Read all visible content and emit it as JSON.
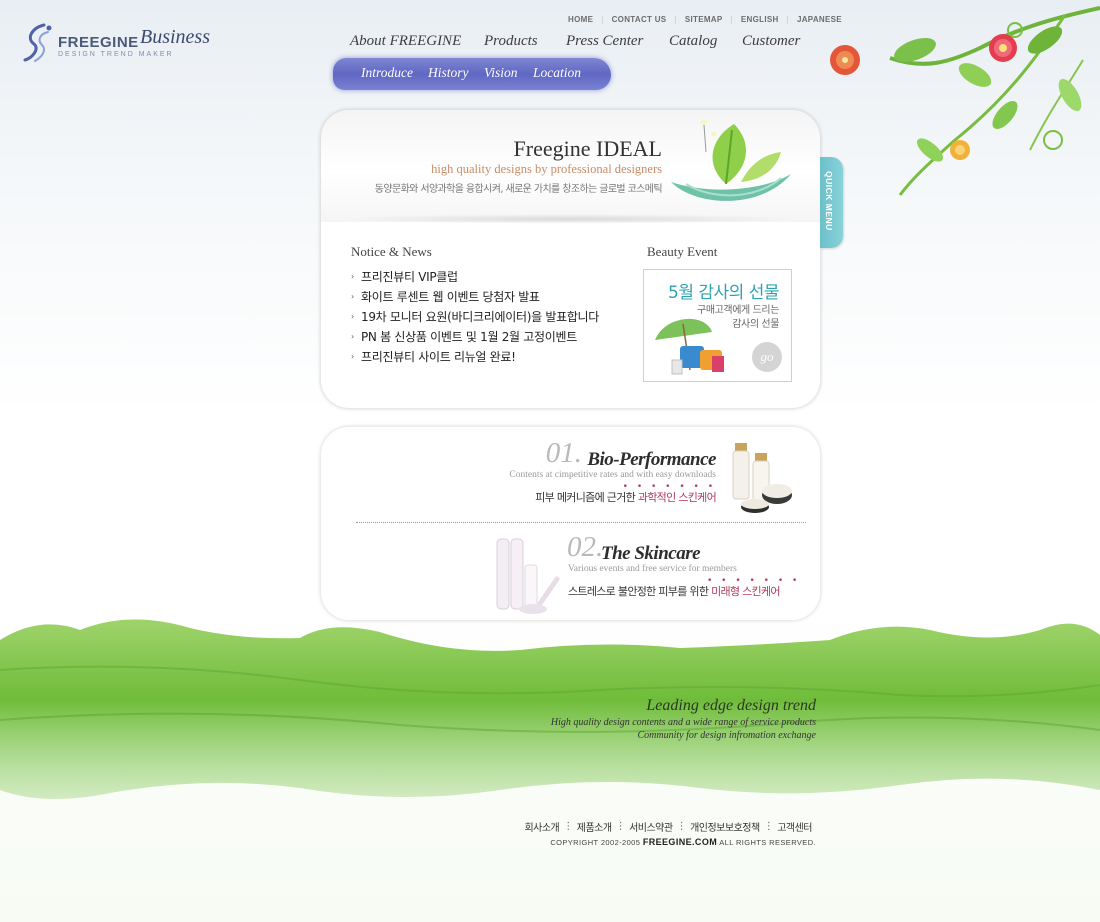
{
  "brand": {
    "name": "FREEGINE",
    "suffix": "Business",
    "tagline": "DESIGN TREND MAKER"
  },
  "util_nav": [
    "HOME",
    "CONTACT US",
    "SITEMAP",
    "ENGLISH",
    "JAPANESE"
  ],
  "main_nav": [
    "About FREEGINE",
    "Products",
    "Press Center",
    "Catalog",
    "Customer"
  ],
  "sub_nav": [
    "Introduce",
    "History",
    "Vision",
    "Location"
  ],
  "quick_menu": "QUICK MENU",
  "ideal": {
    "title": "Freegine IDEAL",
    "subtitle": "high quality designs by professional designers",
    "korean": "동양문화와 서양과학을 융합시켜, 새로운 가치를 창조하는 글로벌 코스메틱"
  },
  "notice": {
    "heading": "Notice & News",
    "items": [
      "프리진뷰티 VIP클럽",
      "화이트 루센트 웹 이벤트 당첨자 발표",
      "19차 모니터 요원(바디크리에이터)을 발표합니다",
      "PN 봄 신상품 이벤트 및 1월 2월 고정이벤트",
      "프리진뷰티 사이트 리뉴얼 완료!"
    ]
  },
  "beauty_event": {
    "heading": "Beauty Event",
    "title": "5월 감사의 선물",
    "sub_line1": "구매고객에게 드리는",
    "sub_line2": "감사의 선물",
    "go": "go"
  },
  "products": [
    {
      "num": "01.",
      "title": "Bio-Performance",
      "desc": "Contents at cimpetitive rates and with easy downloads",
      "korean_plain": "피부 메커니즘에 근거한 ",
      "korean_accent": "과학적인 스킨케어"
    },
    {
      "num": "02.",
      "title": "The Skincare",
      "desc": "Various events and free service for members",
      "korean_plain": "스트레스로 불안정한 피부를 위한 ",
      "korean_accent": "미래형 스킨케어"
    }
  ],
  "slogan": {
    "title": "Leading edge design trend",
    "line1": "High quality design contents and a wide range of service products",
    "line2": "Community for design infromation exchange"
  },
  "footer": {
    "links": [
      "회사소개",
      "제품소개",
      "서비스약관",
      "개인정보보호정책",
      "고객센터"
    ],
    "copyright_pre": "COPYRIGHT 2002-2005",
    "copyright_brand": "FREEGINE.COM",
    "copyright_post": "ALL RIGHTS RESERVED."
  },
  "colors": {
    "subnav_bg": "#6a72c8",
    "quick_menu": "#7ccbd3",
    "accent_orange": "#c98b64",
    "accent_teal": "#2fa3b0",
    "accent_red": "#b03a5a",
    "grass": "#7fc24a"
  }
}
